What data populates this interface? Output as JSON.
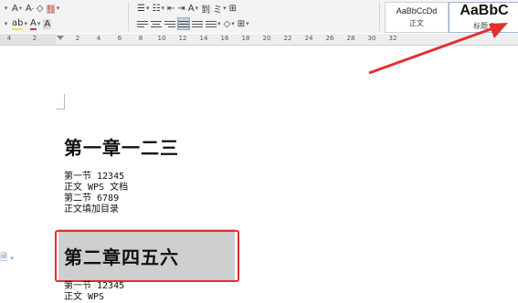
{
  "ribbon": {
    "row1": {
      "font_grow_label": "A",
      "font_shrink_label": "A",
      "clear_format_glyph": "◇",
      "phonetic_label": "䨻",
      "bullets_glyph": "☰",
      "numbering_glyph": "☷",
      "indent_decrease_glyph": "⇤",
      "indent_increase_glyph": "⇥",
      "char_scale_label": "A",
      "sort_label": "到",
      "show_marks_label": "ミ",
      "table_glyph": "⊞"
    },
    "row2": {
      "highlight_label": "ab",
      "font_color_label": "A",
      "char_shading_label": "A",
      "shading_glyph": "◇",
      "border_glyph": "⊞"
    },
    "styles": [
      {
        "sample": "AaBbCcDd",
        "name": "正文"
      },
      {
        "sample": "AaBbC",
        "name": "标题 1"
      }
    ]
  },
  "ruler": {
    "ticks": [
      "4",
      "2",
      "2",
      "4",
      "6",
      "8",
      "10",
      "12",
      "14",
      "16",
      "18",
      "20",
      "22",
      "24",
      "26",
      "28",
      "30",
      "32"
    ]
  },
  "document": {
    "heading1": "第一章一二三",
    "lines1": [
      "第一节 12345",
      "正文 WPS 文档",
      "第二节 6789",
      "正文填加目录"
    ],
    "heading2": "第二章四五六",
    "lines2": [
      "第一节 12345",
      "正文 WPS"
    ]
  },
  "colors": {
    "accent_red": "#e03030",
    "selection_gray": "#cfcfcf",
    "ribbon_bg": "#f3f3f3"
  }
}
